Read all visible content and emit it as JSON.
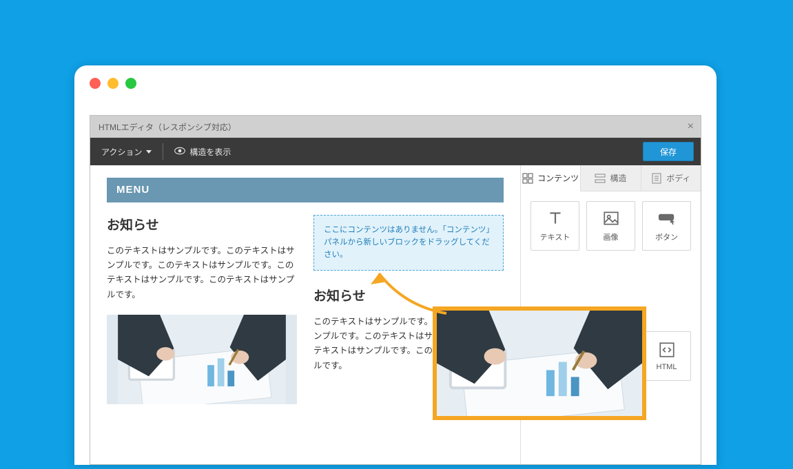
{
  "editor": {
    "dialog_title": "HTMLエディタ（レスポンシブ対応）",
    "action_label": "アクション",
    "structure_toggle_label": "構造を表示",
    "save_label": "保存"
  },
  "canvas": {
    "menu_label": "MENU",
    "section1": {
      "heading": "お知らせ",
      "body": "このテキストはサンプルです。このテキストはサンプルです。このテキストはサンプルです。このテキストはサンプルです。このテキストはサンプルです。"
    },
    "section2": {
      "heading": "お知らせ",
      "body": "このテキストはサンプルです。このテキストはサンプルです。このテキストはサンプルです。このテキストはサンプルです。このテキストはサンプルです。"
    },
    "dropzone_text": "ここにコンテンツはありません。「コンテンツ」パネルから新しいブロックをドラッグしてください。"
  },
  "tabs": {
    "contents": "コンテンツ",
    "structure": "構造",
    "body": "ボディ"
  },
  "blocks": {
    "text": "テキスト",
    "image": "画像",
    "button": "ボタン",
    "divider": "",
    "blank": "",
    "html": "HTML"
  },
  "colors": {
    "accent": "#0FA0E6",
    "save_button": "#2196d6",
    "drag_border": "#f5a623",
    "dropzone_border": "#4aa3d6"
  }
}
